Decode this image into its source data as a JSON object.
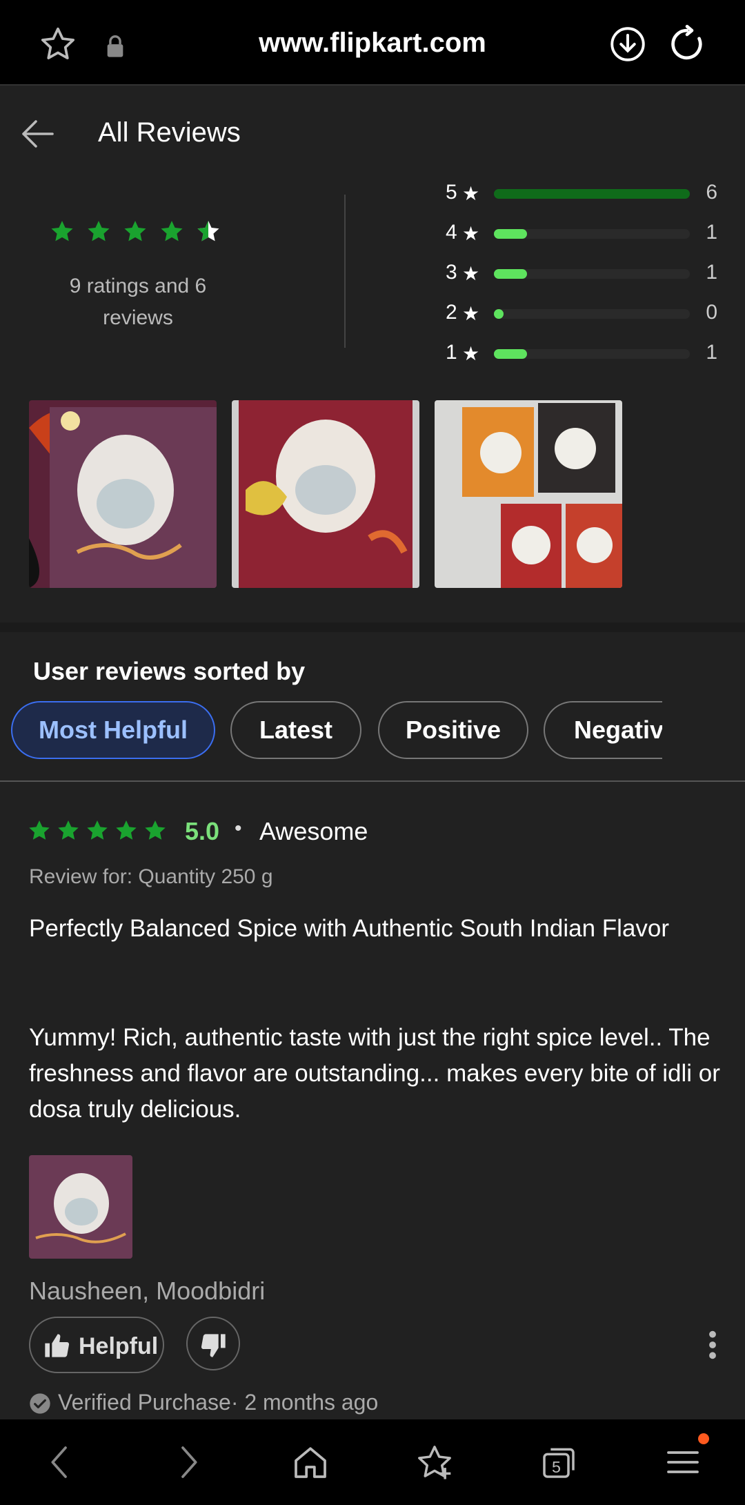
{
  "browser": {
    "url": "www.flipkart.com"
  },
  "header": {
    "title": "All Reviews"
  },
  "summary": {
    "rating_text": "9 ratings and 6 reviews",
    "distribution": [
      {
        "star": "5",
        "count": "6",
        "fraction": 1.0,
        "color": "#0f6b1a"
      },
      {
        "star": "4",
        "count": "1",
        "fraction": 0.17,
        "color": "#5ee35e"
      },
      {
        "star": "3",
        "count": "1",
        "fraction": 0.17,
        "color": "#5ee35e"
      },
      {
        "star": "2",
        "count": "0",
        "fraction": 0.05,
        "color": "#5ee35e"
      },
      {
        "star": "1",
        "count": "1",
        "fraction": 0.17,
        "color": "#5ee35e"
      }
    ],
    "average_stars": 4.5
  },
  "sort": {
    "title": "User reviews sorted by",
    "chips": [
      "Most Helpful",
      "Latest",
      "Positive",
      "Negative"
    ],
    "active": "Most Helpful"
  },
  "review": {
    "score": "5.0",
    "word": "Awesome",
    "review_for": "Review for: Quantity 250 g",
    "title": "Perfectly Balanced Spice with Authentic South Indian Flavor",
    "body": "Yummy! Rich, authentic taste with just the right spice level.. The freshness and flavor are outstanding... makes every bite of idli or dosa truly delicious.",
    "author": "Nausheen, Moodbidri",
    "helpful_label": "Helpful",
    "verified": "Verified Purchase· 2 months ago"
  },
  "colors": {
    "star_green": "#1aa32f",
    "accent_blue": "#3b6ef0",
    "score_green": "#7be07b"
  },
  "icons": {
    "bookmark": "star-outline",
    "lock": "lock",
    "download": "download-circle",
    "reload": "reload",
    "back": "arrow-left"
  },
  "bottom_nav": {
    "tab_count": "5"
  }
}
